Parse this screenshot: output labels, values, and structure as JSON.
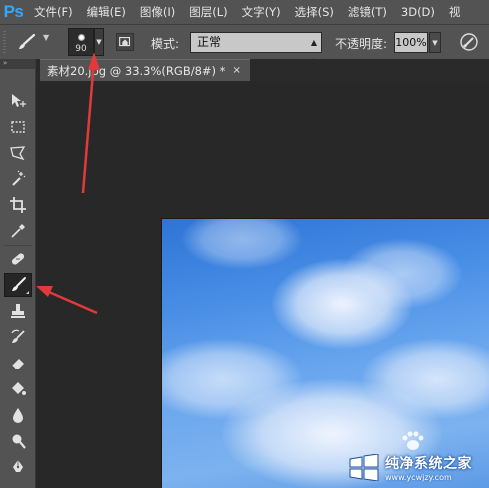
{
  "app": {
    "logo": "Ps"
  },
  "menubar": {
    "items": [
      "文件(F)",
      "编辑(E)",
      "图像(I)",
      "图层(L)",
      "文字(Y)",
      "选择(S)",
      "滤镜(T)",
      "3D(D)",
      "视"
    ]
  },
  "options": {
    "tool_icon": "brush-icon",
    "brush_size": "90",
    "mode_label": "模式:",
    "mode_value": "正常",
    "opacity_label": "不透明度:",
    "opacity_value": "100%"
  },
  "toolbar": {
    "header": "»",
    "tools": [
      {
        "name": "move-tool",
        "icon": "move-icon"
      },
      {
        "name": "marquee-tool",
        "icon": "marquee-icon"
      },
      {
        "name": "lasso-tool",
        "icon": "polygon-lasso-icon"
      },
      {
        "name": "magic-wand-tool",
        "icon": "magic-wand-icon"
      },
      {
        "name": "crop-tool",
        "icon": "crop-icon"
      },
      {
        "name": "eyedropper-tool",
        "icon": "eyedropper-icon"
      },
      {
        "name": "healing-brush-tool",
        "icon": "bandage-icon"
      },
      {
        "name": "brush-tool",
        "icon": "brush-icon",
        "active": true
      },
      {
        "name": "clone-stamp-tool",
        "icon": "stamp-icon"
      },
      {
        "name": "history-brush-tool",
        "icon": "history-brush-icon"
      },
      {
        "name": "eraser-tool",
        "icon": "eraser-icon"
      },
      {
        "name": "paint-bucket-tool",
        "icon": "paint-bucket-icon"
      },
      {
        "name": "blur-tool",
        "icon": "drop-icon"
      },
      {
        "name": "dodge-tool",
        "icon": "dodge-icon"
      },
      {
        "name": "pen-tool",
        "icon": "pen-icon"
      }
    ]
  },
  "document": {
    "tab_title": "素材20.jpg @ 33.3%(RGB/8#) *",
    "tab_close": "×"
  },
  "watermark": {
    "title": "纯净系统之家",
    "url": "www.ycwjzy.com"
  },
  "colors": {
    "ps_blue": "#31a8ff",
    "annotation_red": "#e03a3a",
    "sky": "#4a8fe6"
  }
}
